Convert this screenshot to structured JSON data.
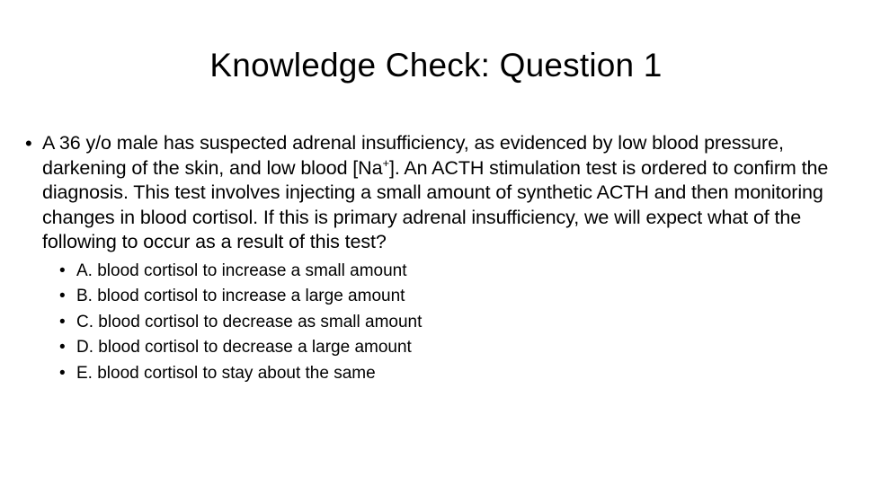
{
  "slide": {
    "title": "Knowledge Check: Question 1",
    "bullet_glyph": "•",
    "question": {
      "before_sup": "A 36 y/o male has suspected adrenal insufficiency, as evidenced by low blood pressure, darkening of the skin, and low blood [Na",
      "sup": "+",
      "after_sup": "]. An ACTH stimulation test is ordered to confirm the diagnosis. This test involves injecting a small amount of synthetic ACTH and then monitoring changes in blood cortisol. If this is primary adrenal insufficiency, we will expect what of the following to occur as a result of this test?"
    },
    "options": [
      "A. blood cortisol to increase a small amount",
      "B. blood cortisol to increase a large amount",
      "C. blood cortisol to decrease as small amount",
      "D. blood cortisol to decrease a large amount",
      "E. blood cortisol to stay about the same"
    ]
  }
}
